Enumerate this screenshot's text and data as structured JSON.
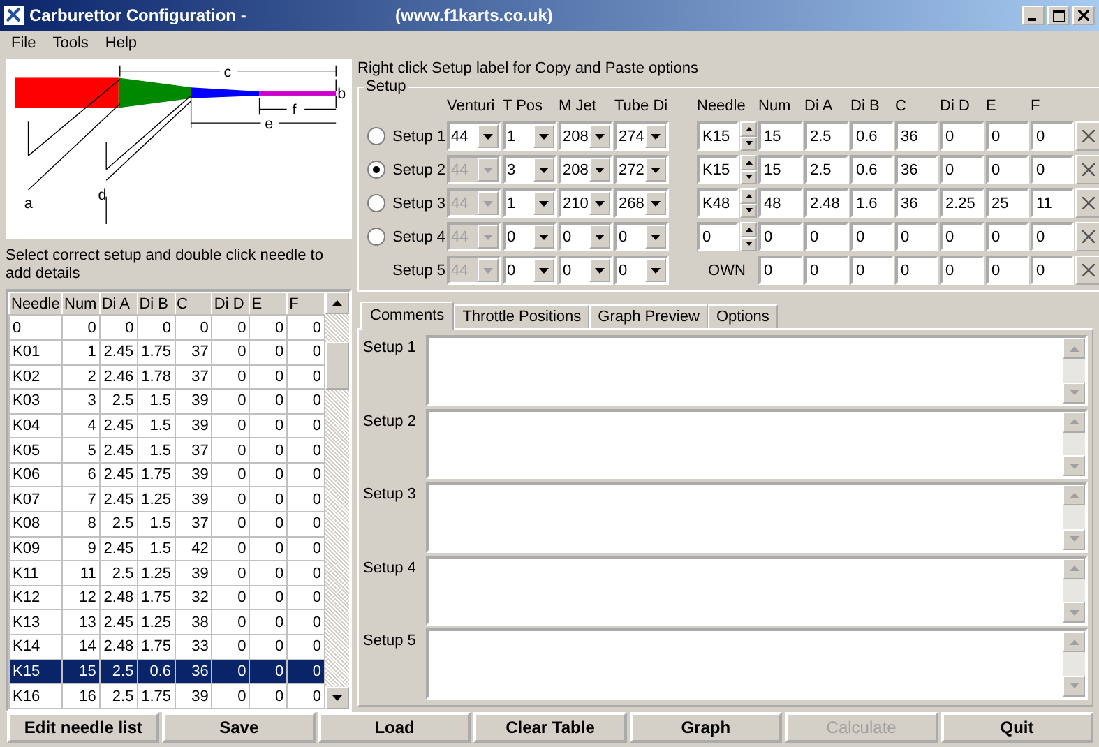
{
  "window": {
    "title": "Carburettor Configuration -",
    "subtitle": "(www.f1karts.co.uk)"
  },
  "menu": [
    "File",
    "Tools",
    "Help"
  ],
  "diagram": {
    "labels": [
      "a",
      "b",
      "c",
      "d",
      "e",
      "f"
    ]
  },
  "hint": "Select correct setup and double click needle to add details",
  "needle_table": {
    "columns": [
      "Needle",
      "Num",
      "Di A",
      "Di B",
      "C",
      "Di D",
      "E",
      "F"
    ],
    "rows": [
      {
        "cells": [
          "0",
          "0",
          "0",
          "0",
          "0",
          "0",
          "0",
          "0"
        ],
        "selected": false
      },
      {
        "cells": [
          "K01",
          "1",
          "2.45",
          "1.75",
          "37",
          "0",
          "0",
          "0"
        ],
        "selected": false
      },
      {
        "cells": [
          "K02",
          "2",
          "2.46",
          "1.78",
          "37",
          "0",
          "0",
          "0"
        ],
        "selected": false
      },
      {
        "cells": [
          "K03",
          "3",
          "2.5",
          "1.5",
          "39",
          "0",
          "0",
          "0"
        ],
        "selected": false
      },
      {
        "cells": [
          "K04",
          "4",
          "2.45",
          "1.5",
          "39",
          "0",
          "0",
          "0"
        ],
        "selected": false
      },
      {
        "cells": [
          "K05",
          "5",
          "2.45",
          "1.5",
          "37",
          "0",
          "0",
          "0"
        ],
        "selected": false
      },
      {
        "cells": [
          "K06",
          "6",
          "2.45",
          "1.75",
          "39",
          "0",
          "0",
          "0"
        ],
        "selected": false
      },
      {
        "cells": [
          "K07",
          "7",
          "2.45",
          "1.25",
          "39",
          "0",
          "0",
          "0"
        ],
        "selected": false
      },
      {
        "cells": [
          "K08",
          "8",
          "2.5",
          "1.5",
          "37",
          "0",
          "0",
          "0"
        ],
        "selected": false
      },
      {
        "cells": [
          "K09",
          "9",
          "2.45",
          "1.5",
          "42",
          "0",
          "0",
          "0"
        ],
        "selected": false
      },
      {
        "cells": [
          "K11",
          "11",
          "2.5",
          "1.25",
          "39",
          "0",
          "0",
          "0"
        ],
        "selected": false
      },
      {
        "cells": [
          "K12",
          "12",
          "2.48",
          "1.75",
          "32",
          "0",
          "0",
          "0"
        ],
        "selected": false
      },
      {
        "cells": [
          "K13",
          "13",
          "2.45",
          "1.25",
          "38",
          "0",
          "0",
          "0"
        ],
        "selected": false
      },
      {
        "cells": [
          "K14",
          "14",
          "2.48",
          "1.75",
          "33",
          "0",
          "0",
          "0"
        ],
        "selected": false
      },
      {
        "cells": [
          "K15",
          "15",
          "2.5",
          "0.6",
          "36",
          "0",
          "0",
          "0"
        ],
        "selected": true
      },
      {
        "cells": [
          "K16",
          "16",
          "2.5",
          "1.75",
          "39",
          "0",
          "0",
          "0"
        ],
        "selected": false
      }
    ]
  },
  "setup_hint": "Right click Setup label for Copy and Paste options",
  "setup": {
    "title": "Setup",
    "columns_left": [
      "Venturi",
      "T Pos",
      "M Jet",
      "Tube Di"
    ],
    "columns_right": [
      "Needle",
      "Num",
      "Di A",
      "Di B",
      "C",
      "Di D",
      "E",
      "F"
    ],
    "rows": [
      {
        "label": "Setup 1",
        "kind": "radio",
        "selected": false,
        "selects": [
          {
            "value": "44",
            "disabled": false
          },
          {
            "value": "1",
            "disabled": false
          },
          {
            "value": "208",
            "disabled": false
          },
          {
            "value": "274",
            "disabled": false
          }
        ],
        "needle": {
          "kind": "spinner",
          "value": "K15"
        },
        "values": [
          "15",
          "2.5",
          "0.6",
          "36",
          "0",
          "0",
          "0"
        ]
      },
      {
        "label": "Setup 2",
        "kind": "radio",
        "selected": true,
        "selects": [
          {
            "value": "44",
            "disabled": true
          },
          {
            "value": "3",
            "disabled": false
          },
          {
            "value": "208",
            "disabled": false
          },
          {
            "value": "272",
            "disabled": false
          }
        ],
        "needle": {
          "kind": "spinner",
          "value": "K15"
        },
        "values": [
          "15",
          "2.5",
          "0.6",
          "36",
          "0",
          "0",
          "0"
        ]
      },
      {
        "label": "Setup 3",
        "kind": "radio",
        "selected": false,
        "selects": [
          {
            "value": "44",
            "disabled": true
          },
          {
            "value": "1",
            "disabled": false
          },
          {
            "value": "210",
            "disabled": false
          },
          {
            "value": "268",
            "disabled": false
          }
        ],
        "needle": {
          "kind": "spinner",
          "value": "K48"
        },
        "values": [
          "48",
          "2.48",
          "1.6",
          "36",
          "2.25",
          "25",
          "11"
        ]
      },
      {
        "label": "Setup 4",
        "kind": "radio",
        "selected": false,
        "selects": [
          {
            "value": "44",
            "disabled": true
          },
          {
            "value": "0",
            "disabled": false
          },
          {
            "value": "0",
            "disabled": false
          },
          {
            "value": "0",
            "disabled": false
          }
        ],
        "needle": {
          "kind": "spinner",
          "value": "0"
        },
        "values": [
          "0",
          "0",
          "0",
          "0",
          "0",
          "0",
          "0"
        ]
      },
      {
        "label": "Setup 5",
        "kind": "plain",
        "selects": [
          {
            "value": "44",
            "disabled": true
          },
          {
            "value": "0",
            "disabled": false
          },
          {
            "value": "0",
            "disabled": false
          },
          {
            "value": "0",
            "disabled": false
          }
        ],
        "needle": {
          "kind": "label",
          "value": "OWN"
        },
        "values": [
          "0",
          "0",
          "0",
          "0",
          "0",
          "0",
          "0"
        ]
      }
    ]
  },
  "tabs": [
    {
      "label": "Comments",
      "selected": true
    },
    {
      "label": "Throttle Positions",
      "selected": false
    },
    {
      "label": "Graph Preview",
      "selected": false
    },
    {
      "label": "Options",
      "selected": false
    }
  ],
  "comments": [
    {
      "label": "Setup 1"
    },
    {
      "label": "Setup 2"
    },
    {
      "label": "Setup 3"
    },
    {
      "label": "Setup 4"
    },
    {
      "label": "Setup 5"
    }
  ],
  "buttons": [
    {
      "label": "Edit needle list",
      "disabled": false
    },
    {
      "label": "Save",
      "disabled": false
    },
    {
      "label": "Load",
      "disabled": false
    },
    {
      "label": "Clear Table",
      "disabled": false
    },
    {
      "label": "Graph",
      "disabled": false
    },
    {
      "label": "Calculate",
      "disabled": true
    },
    {
      "label": "Quit",
      "disabled": false
    }
  ]
}
